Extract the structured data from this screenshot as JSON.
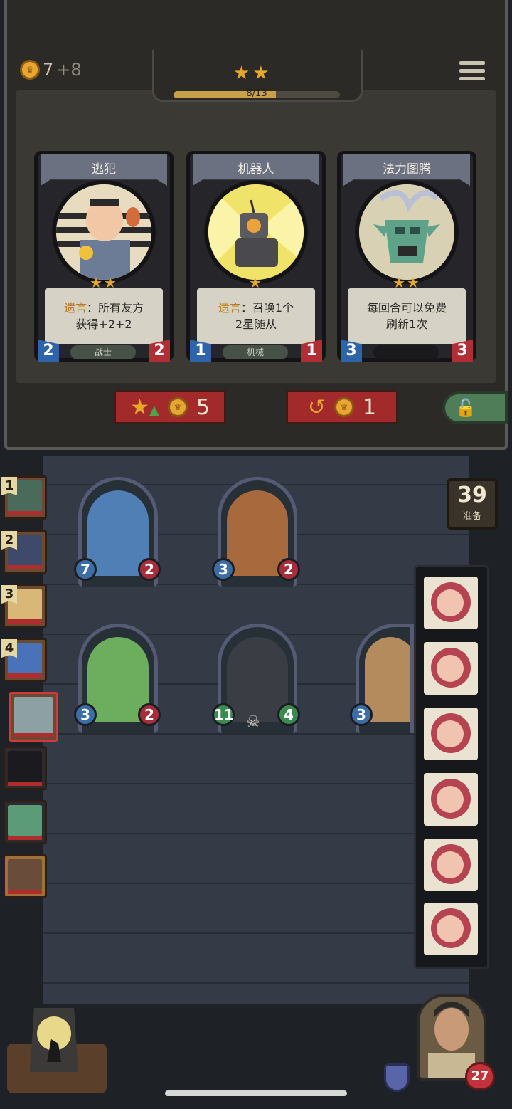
{
  "gold": {
    "current": "7",
    "income": "+8"
  },
  "tier": {
    "stars": "★★",
    "xp_text": "8/13",
    "xp_value": 8,
    "xp_max": 13
  },
  "shop_cards": [
    {
      "name": "逃犯",
      "stars": "★★",
      "keyword": "遗言",
      "desc_line1": "：所有友方",
      "desc_line2": "获得+2+2",
      "tag": "战士",
      "attack": "2",
      "health": "2"
    },
    {
      "name": "机器人",
      "stars": "★",
      "keyword": "遗言",
      "desc_line1": "：召唤1个",
      "desc_line2": "2星随从",
      "tag": "机械",
      "attack": "1",
      "health": "1"
    },
    {
      "name": "法力图腾",
      "stars": "★★",
      "keyword": "",
      "desc_line1": "每回合可以免费",
      "desc_line2": "刷新1次",
      "tag": "",
      "attack": "3",
      "health": "3"
    }
  ],
  "buttons": {
    "upgrade_cost": "5",
    "refresh_cost": "1"
  },
  "timer": {
    "value": "39",
    "label": "准备"
  },
  "board": [
    {
      "attack": "7",
      "health": "2"
    },
    {
      "attack": "3",
      "health": "2"
    },
    {
      "attack": "3",
      "health": "2"
    },
    {
      "attack": "11",
      "health": "4"
    },
    {
      "attack": "3",
      "health": ""
    }
  ],
  "roster_ranks": [
    "1",
    "2",
    "3",
    "4"
  ],
  "hero": {
    "health": "27"
  },
  "colors": {
    "accent_gold": "#e6a82a",
    "button_red": "#a22a2a",
    "lock_green": "#4f7d57"
  }
}
